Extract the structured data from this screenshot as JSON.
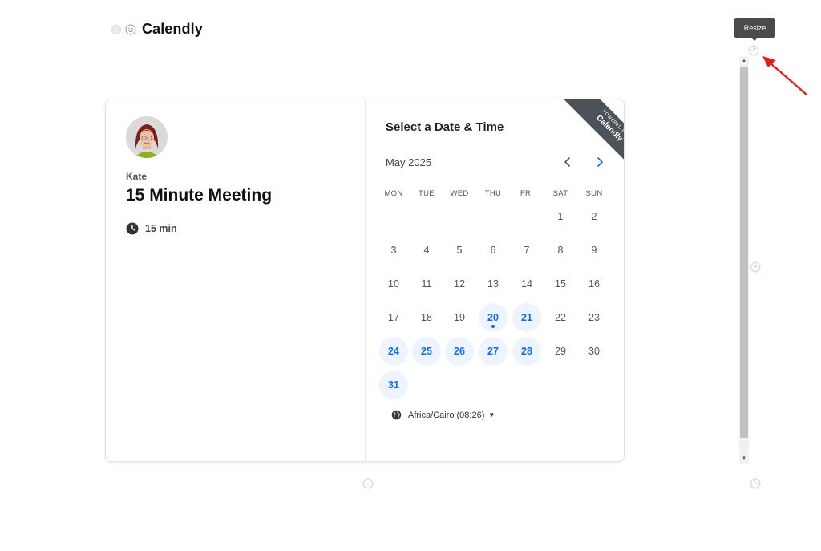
{
  "app": {
    "title": "Calendly"
  },
  "host": {
    "name": "Kate"
  },
  "event": {
    "title": "15 Minute Meeting",
    "duration": "15 min"
  },
  "scheduler": {
    "heading": "Select a Date & Time",
    "month": "May 2025",
    "weekdays": [
      "MON",
      "TUE",
      "WED",
      "THU",
      "FRI",
      "SAT",
      "SUN"
    ],
    "timezone": "Africa/Cairo (08:26)",
    "today": 20,
    "available_days": [
      20,
      21,
      24,
      25,
      26,
      27,
      28,
      31
    ],
    "days": [
      [
        null,
        null,
        null,
        null,
        null,
        1,
        2
      ],
      [
        3,
        4,
        5,
        6,
        7,
        8,
        9
      ],
      [
        10,
        11,
        12,
        13,
        14,
        15,
        16
      ],
      [
        17,
        18,
        19,
        20,
        21,
        22,
        23
      ],
      [
        24,
        25,
        26,
        27,
        28,
        29,
        30
      ],
      [
        31,
        null,
        null,
        null,
        null,
        null,
        null
      ]
    ]
  },
  "ribbon": {
    "small": "POWERED BY",
    "big": "Calendly"
  },
  "tooltip": {
    "resize": "Resize"
  },
  "colors": {
    "accent": "#0b6cf2",
    "available_bg": "#edf4fe",
    "ribbon": "#4b5358",
    "annotation_arrow": "#e02020"
  },
  "icons": {
    "header_dot": "circle-icon",
    "header_smile": "smile-icon",
    "clock": "clock-icon",
    "globe": "globe-icon",
    "prev": "chevron-left-icon",
    "next": "chevron-right-icon"
  }
}
